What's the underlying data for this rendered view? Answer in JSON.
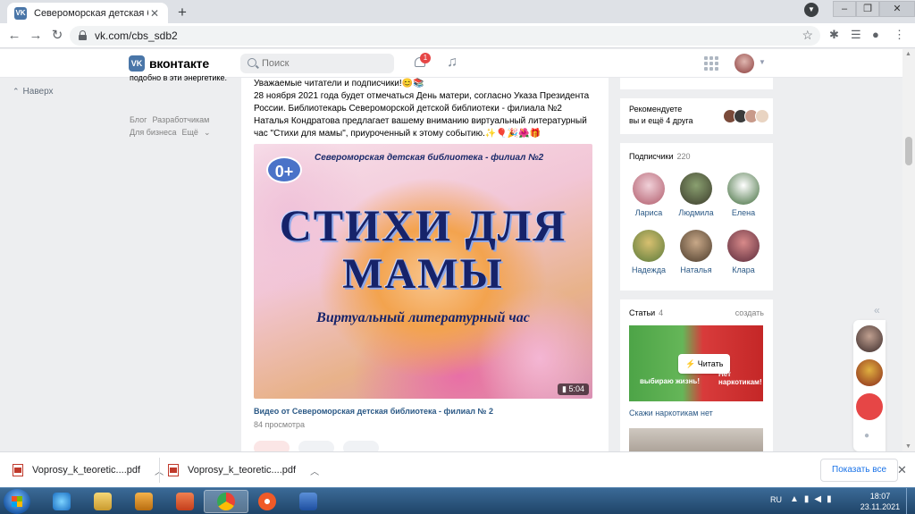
{
  "browser": {
    "tab_title": "Североморская детская библиотека",
    "tab_favicon": "VK",
    "new_tab": "+",
    "url": "vk.com/cbs_sdb2"
  },
  "vk": {
    "logo_text": "вконтакте",
    "logo_mark": "VK",
    "search_placeholder": "Поиск",
    "notifications_badge": "1"
  },
  "left": {
    "nav_label": "Наверх",
    "side_text": "подобно в эти энергетике.",
    "links": [
      "Блог",
      "Разработчикам",
      "Для бизнеса",
      "Ещё"
    ]
  },
  "post": {
    "text_line1": "Уважаемые читатели и подписчики!😊📚",
    "text_body": "28 ноября 2021 года будет отмечаться День матери, согласно Указа Президента России. Библиотекарь Североморской детской библиотеки - филиала №2 Наталья Кондратова предлагает вашему вниманию виртуальный литературный час \"Стихи для мамы\", приуроченный к этому событию.✨🎈🎉🌺🎁",
    "video": {
      "age": "0+",
      "top_label": "Североморская детская библиотека - филиал №2",
      "title_line1": "СТИХИ ДЛЯ",
      "title_line2": "МАМЫ",
      "subtitle": "Виртуальный литературный час",
      "duration": "5:04",
      "caption": "Видео от Североморская детская библиотека - филиал № 2",
      "views": "84 просмотра"
    }
  },
  "right": {
    "recommend_line1": "Рекомендуете",
    "recommend_line2": "вы и ещё 4 друга",
    "subscribers_title": "Подписчики",
    "subscribers_count": "220",
    "subscribers": [
      "Лариса",
      "Людмила",
      "Елена",
      "Надежда",
      "Наталья",
      "Клара"
    ],
    "articles_title": "Статьи",
    "articles_count": "4",
    "articles_create": "создать",
    "read_button": "Читать",
    "article_caption": "Скажи наркотикам нет",
    "article_img_left": "выбираю жизнь!",
    "article_img_right": "Нет наркотикам!"
  },
  "downloads": {
    "items": [
      "Voprosy_k_teoretic....pdf",
      "Voprosy_k_teoretic....pdf"
    ],
    "show_all": "Показать все"
  },
  "taskbar": {
    "lang": "RU",
    "time": "18:07",
    "date": "23.11.2021"
  }
}
